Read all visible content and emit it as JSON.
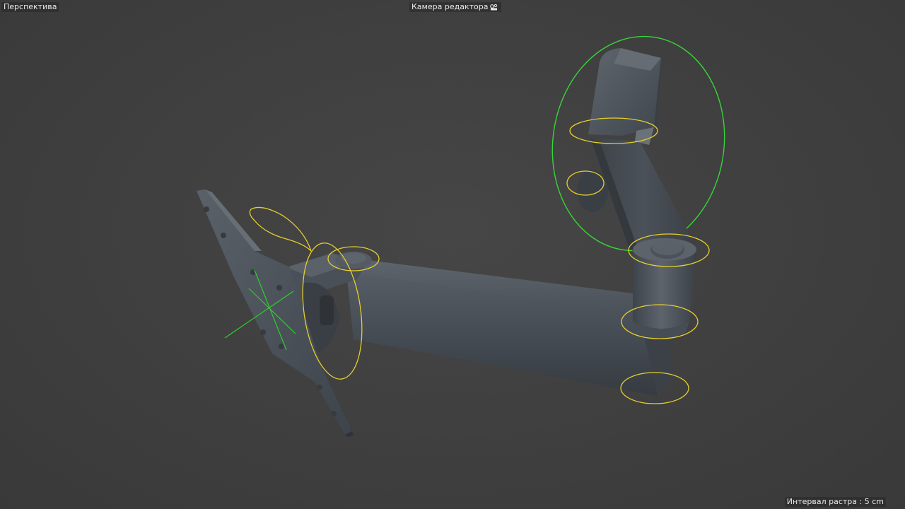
{
  "viewport": {
    "view_name": "Перспектива",
    "camera_label": "Камера редактора",
    "camera_icon": "camera-icon",
    "grid_interval": "Интервал растра : 5 cm"
  },
  "colors": {
    "background": "#3e3e3e",
    "model_body": "#4f565e",
    "joint_handle": "#e6cf2c",
    "selection_ring": "#39d43a",
    "axis_gizmo": "#2bd02b"
  }
}
